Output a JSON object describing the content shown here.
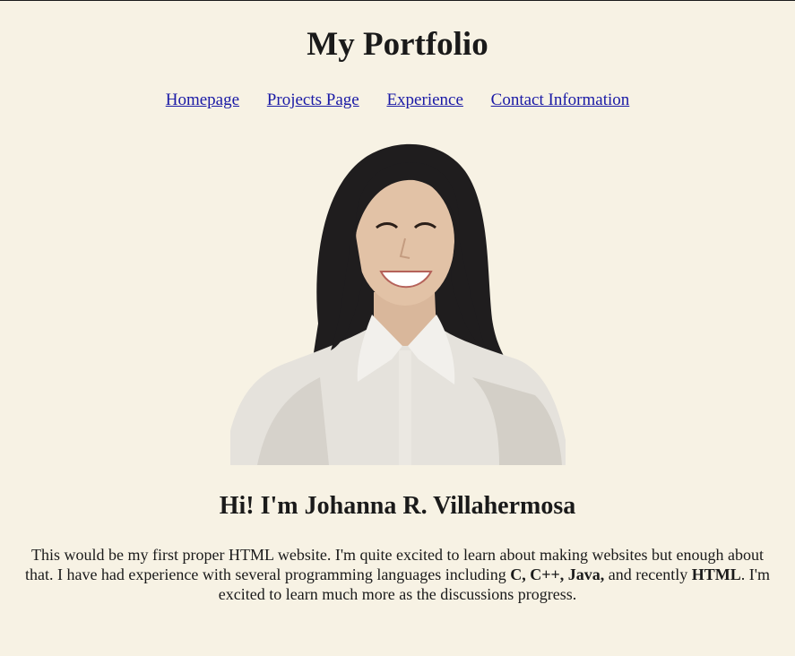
{
  "page": {
    "title": "My Portfolio"
  },
  "nav": {
    "items": [
      {
        "label": "Homepage"
      },
      {
        "label": "Projects Page"
      },
      {
        "label": "Experience"
      },
      {
        "label": "Contact Information"
      }
    ]
  },
  "profile": {
    "greeting": "Hi! I'm Johanna R. Villahermosa",
    "intro": {
      "part1": "This would be my first proper HTML website. I'm quite excited to learn about making websites but enough about that. I have had experience with several programming languages including ",
      "lang1": "C, C++, Java,",
      "part2": " and recently ",
      "lang2": "HTML",
      "part3": ". I'm excited to learn much more as the discussions progress."
    }
  },
  "colors": {
    "background": "#f7f2e4",
    "link": "#1a1aa6",
    "text": "#1a1a1a"
  }
}
